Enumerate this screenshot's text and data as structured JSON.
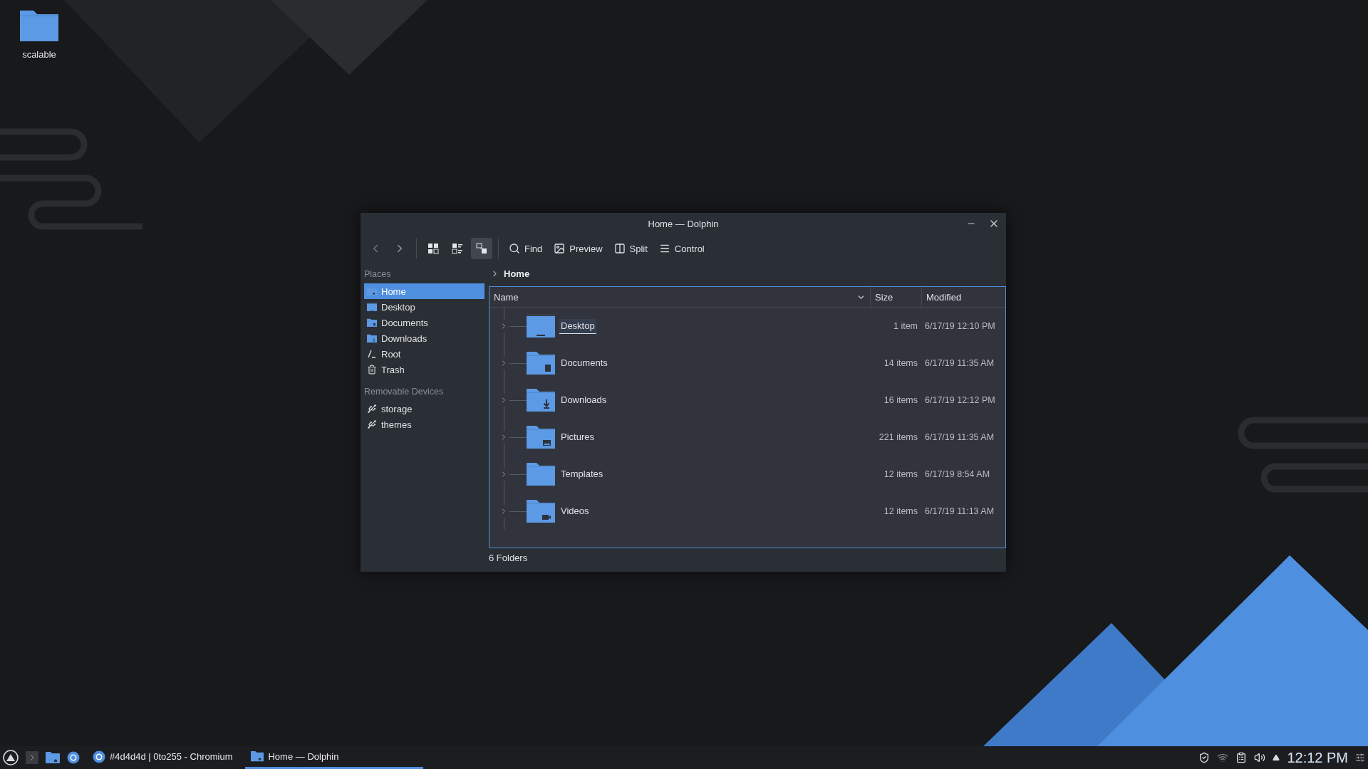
{
  "desktop_icons": [
    {
      "label": "scalable"
    }
  ],
  "window": {
    "title": "Home — Dolphin",
    "view_modes": [
      {
        "kind": "icons",
        "selected": false
      },
      {
        "kind": "compact",
        "selected": false
      },
      {
        "kind": "details",
        "selected": true
      }
    ],
    "toolbar": [
      {
        "kind": "find",
        "label": "Find"
      },
      {
        "kind": "preview",
        "label": "Preview"
      },
      {
        "kind": "split",
        "label": "Split"
      },
      {
        "kind": "control",
        "label": "Control"
      }
    ],
    "sidebar": [
      {
        "heading": "Places",
        "items": [
          {
            "kind": "home",
            "label": "Home",
            "selected": true
          },
          {
            "kind": "desktop",
            "label": "Desktop",
            "selected": false
          },
          {
            "kind": "documents",
            "label": "Documents",
            "selected": false
          },
          {
            "kind": "downloads",
            "label": "Downloads",
            "selected": false
          },
          {
            "kind": "root",
            "label": "Root",
            "selected": false
          },
          {
            "kind": "trash",
            "label": "Trash",
            "selected": false
          }
        ]
      },
      {
        "heading": "Removable Devices",
        "items": [
          {
            "kind": "drive",
            "label": "storage",
            "selected": false
          },
          {
            "kind": "drive",
            "label": "themes",
            "selected": false
          }
        ]
      }
    ],
    "breadcrumb": "Home",
    "columns": [
      "Name",
      "Size",
      "Modified"
    ],
    "rows": [
      {
        "kind": "desktop",
        "name": "Desktop",
        "size": "1 item",
        "modified": "6/17/19 12:10 PM",
        "hovered": true
      },
      {
        "kind": "documents",
        "name": "Documents",
        "size": "14 items",
        "modified": "6/17/19 11:35 AM",
        "hovered": false
      },
      {
        "kind": "downloads",
        "name": "Downloads",
        "size": "16 items",
        "modified": "6/17/19 12:12 PM",
        "hovered": false
      },
      {
        "kind": "pictures",
        "name": "Pictures",
        "size": "221 items",
        "modified": "6/17/19 11:35 AM",
        "hovered": false
      },
      {
        "kind": "templates",
        "name": "Templates",
        "size": "12 items",
        "modified": "6/17/19 8:54 AM",
        "hovered": false
      },
      {
        "kind": "videos",
        "name": "Videos",
        "size": "12 items",
        "modified": "6/17/19 11:13 AM",
        "hovered": false
      }
    ],
    "status": "6 Folders"
  },
  "taskbar": {
    "tasks": [
      {
        "kind": "browser",
        "label": "#4d4d4d | 0to255 - Chromium",
        "selected": false
      },
      {
        "kind": "folder",
        "label": "Home — Dolphin",
        "selected": true
      }
    ],
    "clock": "12:12 PM"
  }
}
